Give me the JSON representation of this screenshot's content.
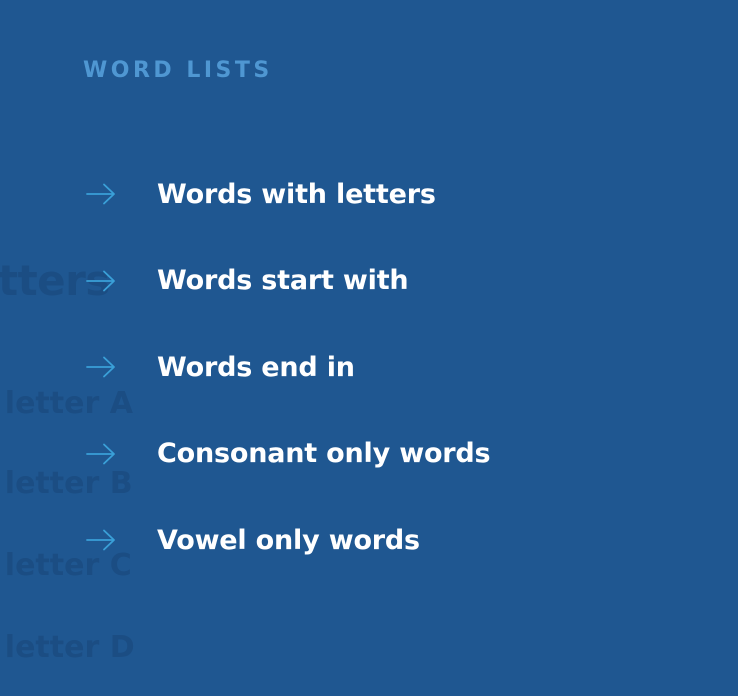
{
  "background_text": {
    "heading": "etters",
    "lines": [
      "e letter A",
      "e letter B",
      "e letter C",
      "e letter D"
    ]
  },
  "word_lists": {
    "title": "WORD LISTS",
    "items": [
      {
        "label": "Words with letters",
        "icon": "arrow-right-icon"
      },
      {
        "label": "Words start with",
        "icon": "arrow-right-icon"
      },
      {
        "label": "Words end in",
        "icon": "arrow-right-icon"
      },
      {
        "label": "Consonant only words",
        "icon": "arrow-right-icon"
      },
      {
        "label": "Vowel only words",
        "icon": "arrow-right-icon"
      }
    ]
  },
  "colors": {
    "background": "#1f5791",
    "title": "#4f97d2",
    "arrow": "#3aa0d8",
    "label": "#ffffff"
  }
}
